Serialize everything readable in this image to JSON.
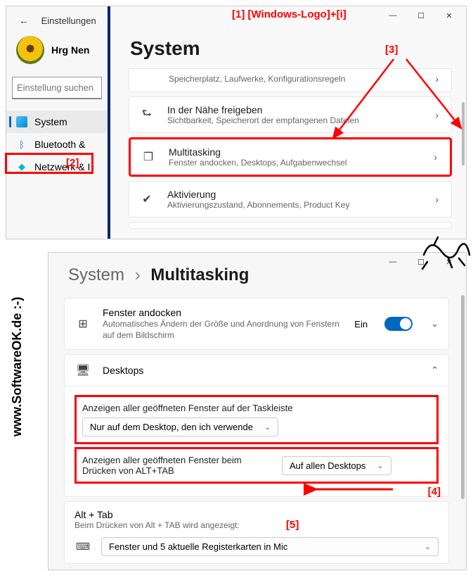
{
  "watermark": "SoftwareOK",
  "sidebar_credit": "www.SoftwareOK.de :-)",
  "annotations": {
    "a1": "[1]  [Windows-Logo]+[i]",
    "a2": "[2]",
    "a3": "[3]",
    "a4": "[4]",
    "a5": "[5]"
  },
  "window1": {
    "back_label": "Einstellungen",
    "username": "Hrg Nen",
    "search_placeholder": "Einstellung suchen",
    "nav": {
      "system": "System",
      "bluetooth": "Bluetooth & ",
      "network": "Netzwerk & I"
    },
    "title": "System",
    "cards": {
      "c0_sub": "Speicherplatz, Laufwerke, Konfigurationsregeln",
      "c1_title": "In der Nähe freigeben",
      "c1_sub": "Sichtbarkeit, Speicherort der empfangenen Dateien",
      "c2_title": "Multitasking",
      "c2_sub": "Fenster andocken, Desktops, Aufgabenwechsel",
      "c3_title": "Aktivierung",
      "c3_sub": "Aktivierungszustand, Abonnements, Product Key"
    }
  },
  "window2": {
    "breadcrumb_root": "System",
    "breadcrumb_sep": "›",
    "breadcrumb_leaf": "Multitasking",
    "snap": {
      "title": "Fenster andocken",
      "sub": "Automatisches Ändern der Größe und Anordnung von Fenstern auf dem Bildschirm",
      "toggle_label": "Ein"
    },
    "desktops": {
      "title": "Desktops",
      "row1_label": "Anzeigen aller geöffneten Fenster auf der Taskleiste",
      "row1_value": "Nur auf dem Desktop, den ich verwende",
      "row2_label": "Anzeigen aller geöffneten Fenster beim Drücken von ALT+TAB",
      "row2_value": "Auf allen Desktops"
    },
    "alttab": {
      "title": "Alt + Tab",
      "sub": "Beim Drücken von Alt + TAB wird angezeigt:",
      "value": "Fenster und 5 aktuelle Registerkarten in Mic"
    }
  }
}
